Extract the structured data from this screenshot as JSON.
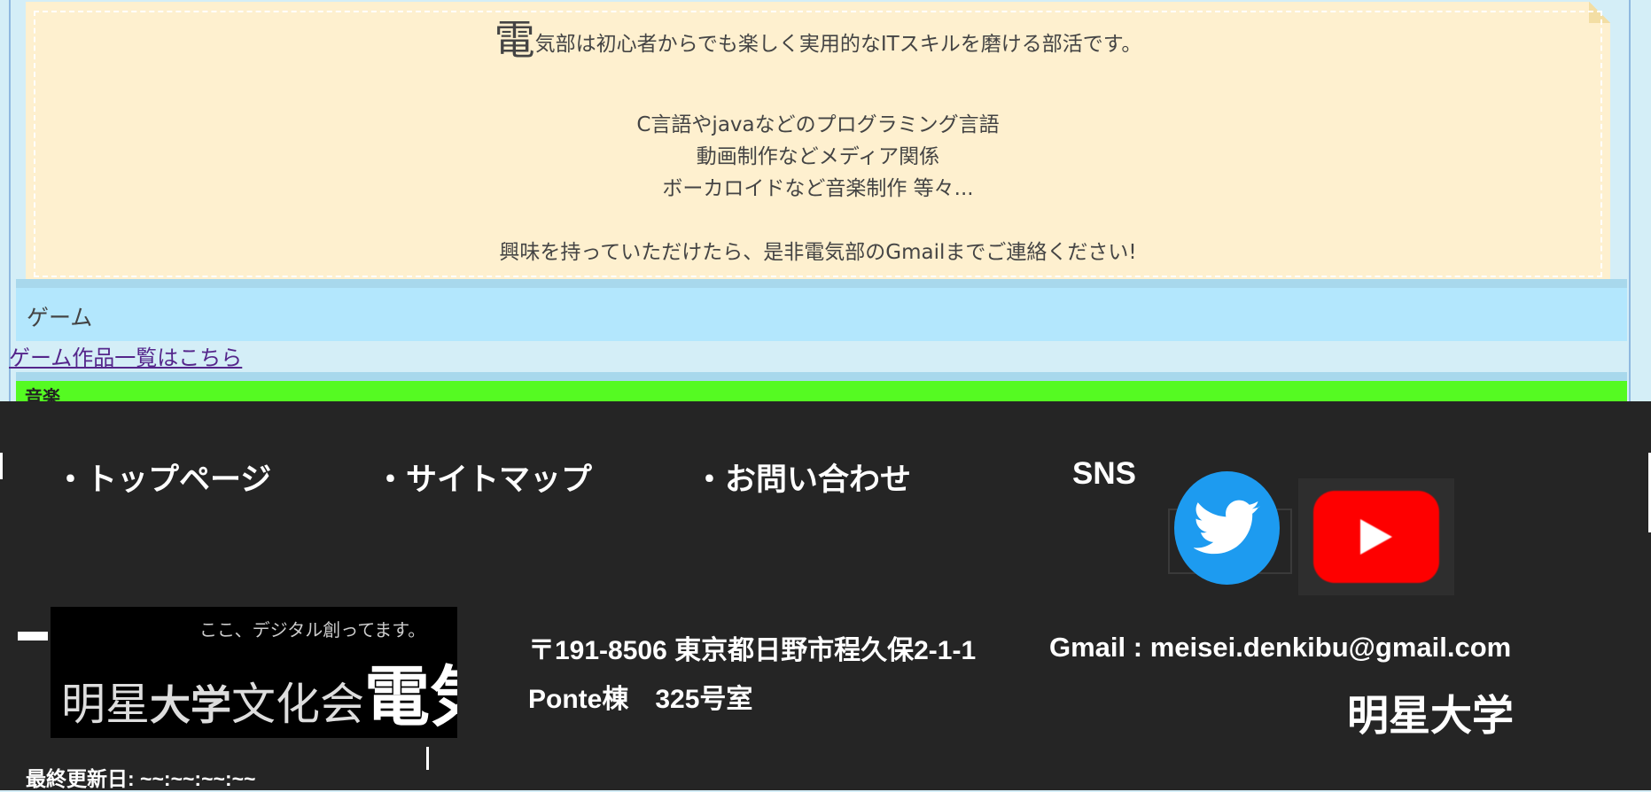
{
  "intro": {
    "big_char": "電",
    "line1_rest": "気部は初心者からでも楽しく実用的なITスキルを磨ける部活です。",
    "items": [
      "C言語やjavaなどのプログラミング言語",
      "動画制作などメディア関係",
      "ボーカロイドなど音楽制作 等々..."
    ],
    "contact": "興味を持っていただけたら、是非電気部のGmailまでご連絡ください!"
  },
  "game_section": {
    "heading": "ゲーム",
    "link": "ゲーム作品一覧はこちら"
  },
  "music_section": {
    "heading": "音楽"
  },
  "footer": {
    "nav": [
      "・トップページ",
      "・サイトマップ",
      "・お問い合わせ"
    ],
    "sns_label": "SNS",
    "logo": {
      "tagline": "ここ、デジタル創ってます。",
      "text_a": "明星",
      "text_b": "大学",
      "text_c": "文化会",
      "text_d": "電気部"
    },
    "address_line1": "〒191-8506 東京都日野市程久保2-1-1",
    "address_line2": "Ponte棟　325号室",
    "gmail": "Gmail : meisei.denkibu@gmail.com",
    "university": "明星大学",
    "last_updated": "最終更新日: ~~:~~:~~:~~",
    "icons": {
      "twitter": "twitter-bird-icon",
      "youtube": "youtube-play-icon"
    },
    "colors": {
      "twitter": "#1d9bf0",
      "youtube": "#fe0000",
      "footer_bg": "#252525"
    }
  }
}
